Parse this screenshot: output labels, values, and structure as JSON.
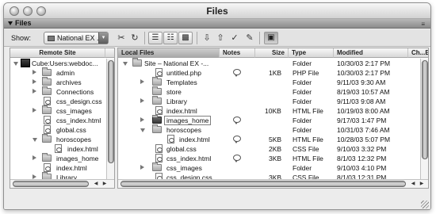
{
  "window": {
    "title": "Files"
  },
  "panel": {
    "title": "Files"
  },
  "toolbar": {
    "show_label": "Show:",
    "site_value": "National EX ...",
    "icons": [
      "connect-icon",
      "refresh-icon",
      "view-site-files-icon",
      "view-testing-server-icon",
      "view-repository-icon",
      "get-icon",
      "put-icon",
      "check-out-icon",
      "check-in-icon",
      "expand-collapse-icon"
    ]
  },
  "remote": {
    "header": "Remote Site",
    "root": "Cube:Users:webdoc...",
    "items": [
      {
        "name": "admin",
        "type": "folder"
      },
      {
        "name": "archives",
        "type": "folder"
      },
      {
        "name": "Connections",
        "type": "folder"
      },
      {
        "name": "css_design.css",
        "type": "file"
      },
      {
        "name": "css_images",
        "type": "folder"
      },
      {
        "name": "css_index.html",
        "type": "file"
      },
      {
        "name": "global.css",
        "type": "file"
      },
      {
        "name": "horoscopes",
        "type": "folder"
      },
      {
        "name": "index.html",
        "type": "file"
      },
      {
        "name": "images_home",
        "type": "folder"
      },
      {
        "name": "index.html",
        "type": "file"
      },
      {
        "name": "Library",
        "type": "folder"
      }
    ]
  },
  "local": {
    "columns": {
      "local_files": "Local Files",
      "notes": "Notes",
      "size": "Size",
      "type": "Type",
      "modified": "Modified",
      "checked_out": "Ch...By"
    },
    "rows": [
      {
        "name": "Site – National EX -...",
        "note": false,
        "size": "",
        "type": "Folder",
        "modified": "10/30/03 2:17 PM"
      },
      {
        "name": "untitled.php",
        "note": true,
        "size": "1KB",
        "type": "PHP File",
        "modified": "10/30/03 2:17 PM"
      },
      {
        "name": "Templates",
        "note": false,
        "size": "",
        "type": "Folder",
        "modified": "9/11/03 9:30 AM"
      },
      {
        "name": "store",
        "note": false,
        "size": "",
        "type": "Folder",
        "modified": "8/19/03 10:57 AM"
      },
      {
        "name": "Library",
        "note": false,
        "size": "",
        "type": "Folder",
        "modified": "9/11/03 9:08 AM"
      },
      {
        "name": "index.html",
        "note": false,
        "size": "10KB",
        "type": "HTML File",
        "modified": "10/19/03 8:00 AM"
      },
      {
        "name": "images_home",
        "note": true,
        "size": "",
        "type": "Folder",
        "modified": "9/17/03 1:47 PM"
      },
      {
        "name": "horoscopes",
        "note": false,
        "size": "",
        "type": "Folder",
        "modified": "10/31/03 7:46 AM"
      },
      {
        "name": "index.html",
        "note": true,
        "size": "5KB",
        "type": "HTML File",
        "modified": "10/28/03 5:07 PM"
      },
      {
        "name": "global.css",
        "note": false,
        "size": "2KB",
        "type": "CSS File",
        "modified": "9/10/03 3:32 PM"
      },
      {
        "name": "css_index.html",
        "note": true,
        "size": "3KB",
        "type": "HTML File",
        "modified": "8/1/03 12:32 PM"
      },
      {
        "name": "css_images",
        "note": false,
        "size": "",
        "type": "Folder",
        "modified": "9/10/03 4:10 PM"
      },
      {
        "name": "css_design.css",
        "note": false,
        "size": "3KB",
        "type": "CSS File",
        "modified": "8/1/03 12:31 PM"
      }
    ]
  }
}
